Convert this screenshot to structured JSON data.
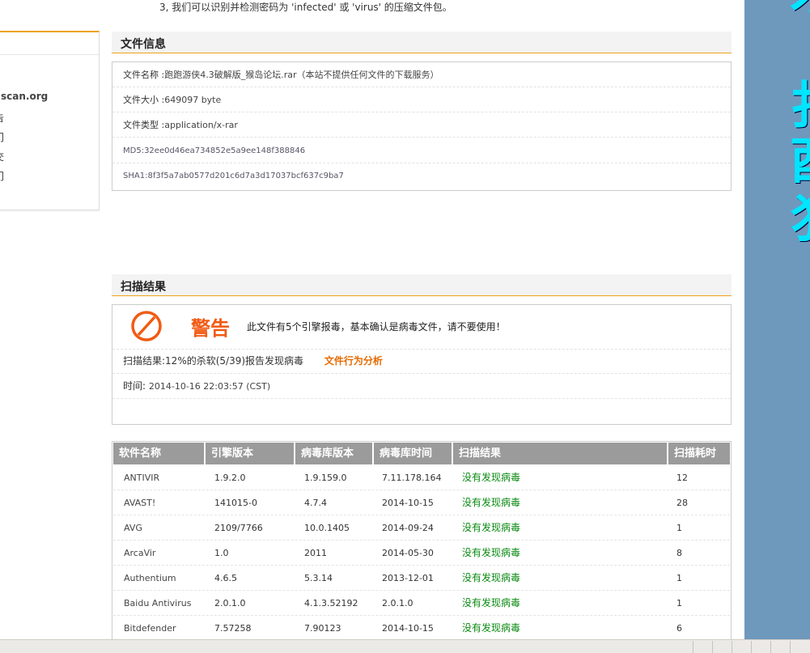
{
  "top_note": "3, 我们可以识别并检测密码为 'infected' 或 'virus' 的压缩文件包。",
  "left_box": {
    "title": "scan.org",
    "items": [
      "告",
      "门",
      "交",
      "门"
    ]
  },
  "right_panel": {
    "glyphs": [
      "才",
      "扌",
      "酉",
      "犭"
    ]
  },
  "file_info": {
    "heading": "文件信息",
    "rows": [
      {
        "label": "文件名称 :",
        "value": "跑跑游侠4.3破解版_猴岛论坛.rar（本站不提供任何文件的下载服务）"
      },
      {
        "label": "文件大小 :",
        "value": "649097 byte"
      },
      {
        "label": "文件类型 :",
        "value": "application/x-rar"
      },
      {
        "label": "MD5:",
        "value": "32ee0d46ea734852e5a9ee148f388846"
      },
      {
        "label": "SHA1:",
        "value": "8f3f5a7ab0577d201c6d7a3d17037bcf637c9ba7"
      }
    ]
  },
  "scan": {
    "heading": "扫描结果",
    "warn_title": "警告",
    "warn_msg": "此文件有5个引擎报毒，基本确认是病毒文件，请不要使用！",
    "result_label": "扫描结果:",
    "result_value": "12%的杀软(5/39)报告发现病毒",
    "behavior_link": "文件行为分析",
    "time_label": "时间:",
    "time_value": "2014-10-16 22:03:57 (CST)"
  },
  "table": {
    "headers": [
      "软件名称",
      "引擎版本",
      "病毒库版本",
      "病毒库时间",
      "扫描结果",
      "扫描耗时"
    ],
    "rows": [
      {
        "name": "ANTIVIR",
        "engine": "1.9.2.0",
        "db": "1.9.159.0",
        "db_time": "7.11.178.164",
        "result": "没有发现病毒",
        "time": "12"
      },
      {
        "name": "AVAST!",
        "engine": "141015-0",
        "db": "4.7.4",
        "db_time": "2014-10-15",
        "result": "没有发现病毒",
        "time": "28"
      },
      {
        "name": "AVG",
        "engine": "2109/7766",
        "db": "10.0.1405",
        "db_time": "2014-09-24",
        "result": "没有发现病毒",
        "time": "1"
      },
      {
        "name": "ArcaVir",
        "engine": "1.0",
        "db": "2011",
        "db_time": "2014-05-30",
        "result": "没有发现病毒",
        "time": "8"
      },
      {
        "name": "Authentium",
        "engine": "4.6.5",
        "db": "5.3.14",
        "db_time": "2013-12-01",
        "result": "没有发现病毒",
        "time": "1"
      },
      {
        "name": "Baidu Antivirus",
        "engine": "2.0.1.0",
        "db": "4.1.3.52192",
        "db_time": "2.0.1.0",
        "result": "没有发现病毒",
        "time": "1"
      },
      {
        "name": "Bitdefender",
        "engine": "7.57258",
        "db": "7.90123",
        "db_time": "2014-10-15",
        "result": "没有发现病毒",
        "time": "6"
      }
    ]
  },
  "colors": {
    "accent": "#f0a21e",
    "warn": "#f15a13",
    "clean": "#0a8a12",
    "table_header": "#9b9b9b",
    "side_panel": "#6f98bd"
  }
}
